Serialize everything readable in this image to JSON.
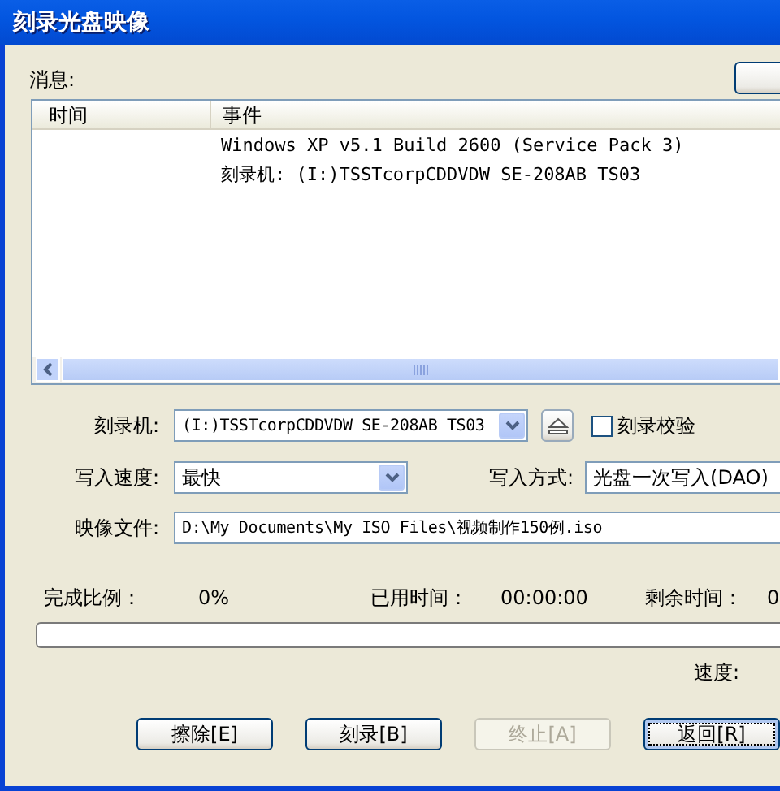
{
  "window": {
    "title": "刻录光盘映像"
  },
  "messages": {
    "label": "消息:",
    "columns": [
      "时间",
      "事件"
    ],
    "rows": [
      {
        "event": "Windows XP v5.1 Build 2600 (Service Pack 3)"
      },
      {
        "event": "刻录机: (I:)TSSTcorpCDDVDW SE-208AB TS03"
      }
    ]
  },
  "form": {
    "burner": {
      "label": "刻录机:",
      "value": "(I:)TSSTcorpCDDVDW SE-208AB TS03"
    },
    "verify": {
      "label": "刻录校验",
      "checked": false
    },
    "speed": {
      "label": "写入速度:",
      "value": "最快"
    },
    "write_mode": {
      "label": "写入方式:",
      "value": "光盘一次写入(DAO)"
    },
    "image_file": {
      "label": "映像文件:",
      "value": "D:\\My Documents\\My ISO Files\\视频制作150例.iso"
    }
  },
  "progress": {
    "done_label": "完成比例：",
    "done_value": "0%",
    "elapsed_label": "已用时间：",
    "elapsed_value": "00:00:00",
    "remaining_label": "剩余时间：",
    "remaining_value": "0",
    "speed_label": "速度:"
  },
  "buttons": [
    {
      "label": "擦除[E]",
      "disabled": false,
      "focused": false
    },
    {
      "label": "刻录[B]",
      "disabled": false,
      "focused": false
    },
    {
      "label": "终止[A]",
      "disabled": true,
      "focused": false
    },
    {
      "label": "返回[R]",
      "disabled": false,
      "focused": true
    }
  ]
}
